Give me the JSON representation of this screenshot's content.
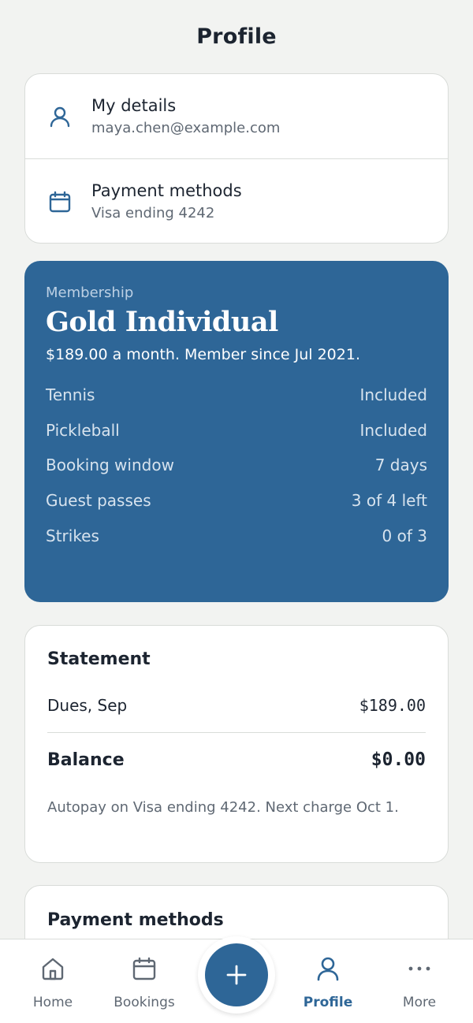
{
  "header": {
    "title": "Profile"
  },
  "links": [
    {
      "title": "My details",
      "subtitle": "maya.chen@example.com",
      "icon": "person-icon"
    },
    {
      "title": "Payment methods",
      "subtitle": "Visa ending 4242",
      "icon": "calendar-icon"
    }
  ],
  "membership": {
    "label": "Membership",
    "plan": "Gold Individual",
    "description": "$189.00 a month. Member since Jul 2021.",
    "rows": [
      {
        "name": "Tennis",
        "value": "Included"
      },
      {
        "name": "Pickleball",
        "value": "Included"
      },
      {
        "name": "Booking window",
        "value": "7 days"
      },
      {
        "name": "Guest passes",
        "value": "3 of 4 left"
      },
      {
        "name": "Strikes",
        "value": "0 of 3"
      }
    ]
  },
  "statement": {
    "title": "Statement",
    "line_label": "Dues, Sep",
    "line_amount": "$189.00",
    "balance_label": "Balance",
    "balance_amount": "$0.00",
    "note": "Autopay on Visa ending 4242. Next charge Oct 1."
  },
  "payment_section": {
    "title": "Payment methods"
  },
  "tabbar": {
    "tabs": [
      {
        "label": "Home",
        "icon": "home-icon"
      },
      {
        "label": "Bookings",
        "icon": "calendar-icon"
      },
      {
        "label": "Profile",
        "icon": "person-icon",
        "active": true
      },
      {
        "label": "More",
        "icon": "more-dots-icon"
      }
    ],
    "fab_icon": "plus-icon"
  },
  "colors": {
    "accent": "#2e6697",
    "background": "#f2f3f1",
    "text": "#1c2430",
    "muted": "#5f6873"
  }
}
